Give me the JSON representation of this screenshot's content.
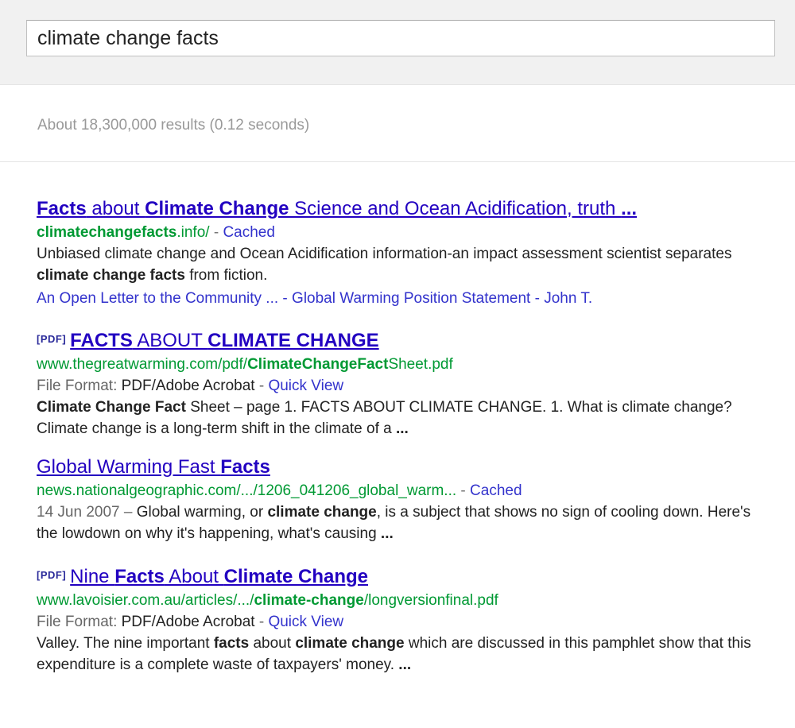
{
  "search": {
    "query": "climate change facts"
  },
  "stats": "About 18,300,000 results (0.12 seconds)",
  "results": [
    {
      "title": {
        "a": "Facts",
        "b": " about ",
        "c": "Climate Change",
        "d": " Science and Ocean Acidification, truth ",
        "e": "..."
      },
      "url": {
        "bold": "climatechangefacts",
        "rest": ".info/",
        "sep": " - ",
        "cached": "Cached"
      },
      "snippet": {
        "p1": "Unbiased climate change and Ocean Acidification information-an impact assessment scientist separates ",
        "b1": "climate change facts",
        "p2": " from fiction."
      },
      "sitelinks": {
        "link1": "An Open Letter to the Community ...",
        "sep1": " - ",
        "link2": "Global Warming Position Statement",
        "sep2": " - ",
        "link3": "John T."
      }
    },
    {
      "tag": "[PDF]",
      "title": {
        "a": "FACTS",
        "b": " ABOUT ",
        "c": "CLIMATE CHANGE"
      },
      "url": {
        "p1": "www.thegreatwarming.com/pdf/",
        "b1": "ClimateChangeFact",
        "p2": "Sheet.pdf"
      },
      "meta": {
        "label": "File Format: ",
        "value": "PDF/Adobe Acrobat",
        "sep": " - ",
        "link": "Quick View"
      },
      "snippet": {
        "b1": "Climate Change Fact",
        "p1": " Sheet – page 1. FACTS ABOUT CLIMATE CHANGE. 1. What is climate change? Climate change is a long-term shift in the climate of a ",
        "b2": "..."
      }
    },
    {
      "title": {
        "a": "Global Warming Fast ",
        "b": "Facts"
      },
      "url": {
        "p1": "news.nationalgeographic.com/.../1206_041206_global_warm...",
        "sep": " - ",
        "cached": "Cached"
      },
      "snippet": {
        "date": "14 Jun 2007 – ",
        "p1": "Global warming, or ",
        "b1": "climate change",
        "p2": ", is a subject that shows no sign of cooling down. Here's the lowdown on why it's happening, what's causing ",
        "b2": "..."
      }
    },
    {
      "tag": "[PDF]",
      "title": {
        "a": "Nine ",
        "b": "Facts",
        "c": " About ",
        "d": "Climate Change"
      },
      "url": {
        "p1": "www.lavoisier.com.au/articles/.../",
        "b1": "climate-change",
        "p2": "/longversionfinal.pdf"
      },
      "meta": {
        "label": "File Format: ",
        "value": "PDF/Adobe Acrobat",
        "sep": " - ",
        "link": "Quick View"
      },
      "snippet": {
        "p1": "Valley. The nine important ",
        "b1": "facts",
        "p2": " about ",
        "b2": "climate change",
        "p3": " which are discussed in this pamphlet show that this expenditure is a complete waste of taxpayers' money. ",
        "b3": "..."
      }
    }
  ]
}
